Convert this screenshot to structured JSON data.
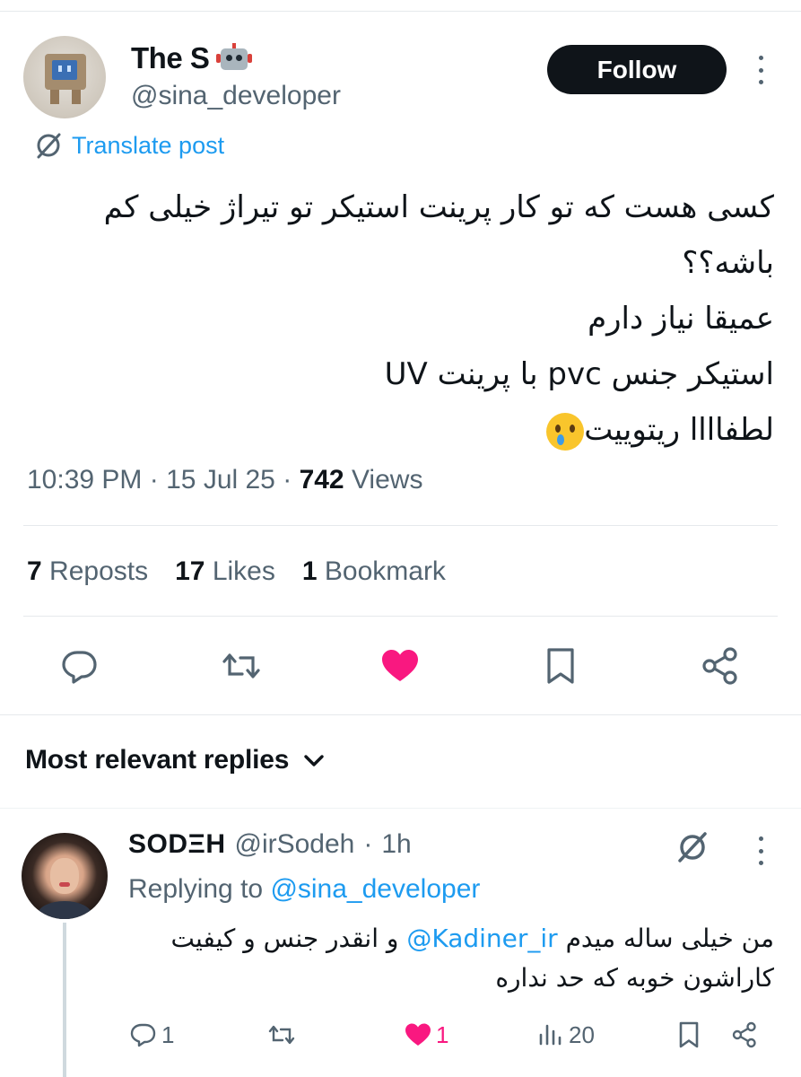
{
  "post": {
    "display_name": "The S",
    "handle": "@sina_developer",
    "follow_label": "Follow",
    "translate_label": "Translate post",
    "body_lines": [
      "کسی هست که تو کار پرینت استیکر تو تیراژ خیلی کم",
      "باشه؟؟",
      "عمیقا نیاز دارم",
      "استیکر جنس pvc با پرینت UV",
      "لطفاااا ریتوییت"
    ],
    "time": "10:39 PM",
    "date": "15 Jul 25",
    "views_count": "742",
    "views_label": "Views",
    "separator": "·",
    "reposts_count": "7",
    "reposts_label": "Reposts",
    "likes_count": "17",
    "likes_label": "Likes",
    "bookmarks_count": "1",
    "bookmarks_label": "Bookmark",
    "liked": true
  },
  "replies_header": {
    "label": "Most relevant replies"
  },
  "reply": {
    "display_name": "SODΞH",
    "handle": "@irSodeh",
    "time_ago": "1h",
    "separator": "·",
    "replying_prefix": "Replying to",
    "replying_mention": "@sina_developer",
    "body_line1_before": "من خیلی ساله میدم",
    "body_mention": "@Kadiner_ir",
    "body_line1_after": "و انقدر جنس و کیفیت",
    "body_line2": "کاراشون خوبه که حد نداره",
    "reply_count": "1",
    "like_count": "1",
    "views_count": "20"
  },
  "colors": {
    "text": "#0f1419",
    "secondary": "#536471",
    "link": "#1d9bf0",
    "like": "#f91880",
    "divider": "#e6e9ec"
  },
  "icons": {
    "translate": "globe-slash-icon",
    "reply": "reply-bubble-icon",
    "repost": "repost-icon",
    "like": "heart-icon",
    "bookmark": "bookmark-icon",
    "share": "share-icon",
    "more": "more-vertical-icon",
    "grok": "grok-icon",
    "views": "views-bar-icon",
    "chevron": "chevron-down-icon"
  }
}
